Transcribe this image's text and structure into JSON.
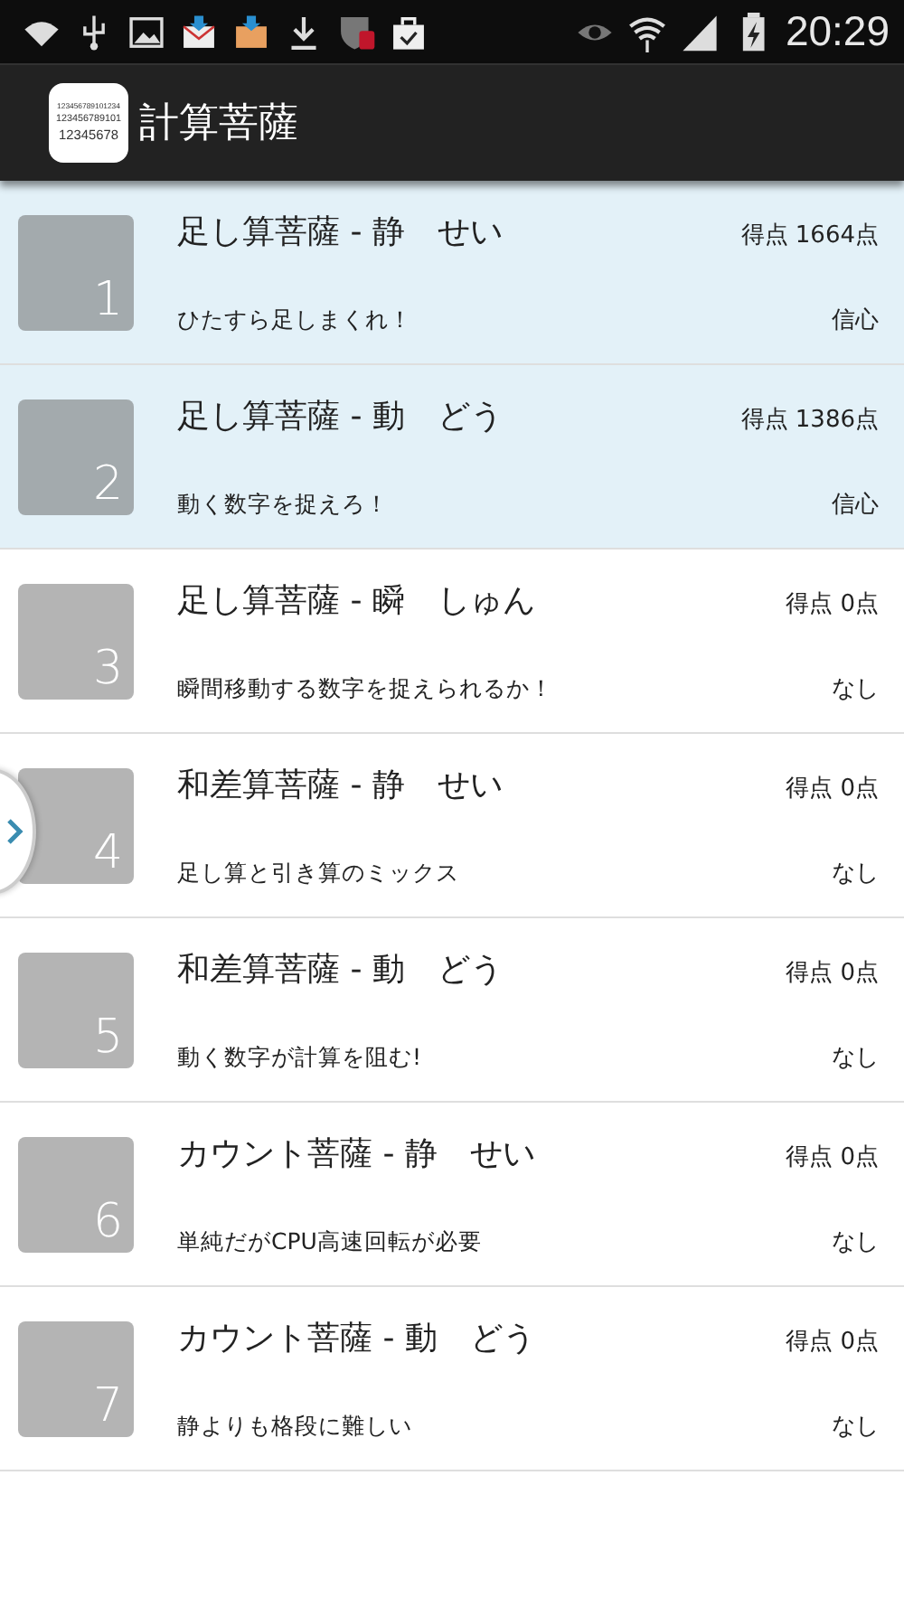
{
  "status_bar": {
    "time": "20:29"
  },
  "app_bar": {
    "icon_lines": [
      "123456789101234",
      "123456789101",
      "12345678"
    ],
    "title": "計算菩薩"
  },
  "games": [
    {
      "number": "1",
      "title": "足し算菩薩 - 静　せい",
      "score": "得点 1664点",
      "subtitle": "ひたすら足しまくれ！",
      "rank": "信心",
      "cleared": true
    },
    {
      "number": "2",
      "title": "足し算菩薩 - 動　どう",
      "score": "得点 1386点",
      "subtitle": "動く数字を捉えろ！",
      "rank": "信心",
      "cleared": true
    },
    {
      "number": "3",
      "title": "足し算菩薩 - 瞬　しゅん",
      "score": "得点 0点",
      "subtitle": "瞬間移動する数字を捉えられるか！",
      "rank": "なし",
      "cleared": false
    },
    {
      "number": "4",
      "title": "和差算菩薩 - 静　せい",
      "score": "得点 0点",
      "subtitle": "足し算と引き算のミックス",
      "rank": "なし",
      "cleared": false
    },
    {
      "number": "5",
      "title": "和差算菩薩 - 動　どう",
      "score": "得点 0点",
      "subtitle": "動く数字が計算を阻む!",
      "rank": "なし",
      "cleared": false
    },
    {
      "number": "6",
      "title": "カウント菩薩 - 静　せい",
      "score": "得点 0点",
      "subtitle": "単純だがCPU高速回転が必要",
      "rank": "なし",
      "cleared": false
    },
    {
      "number": "7",
      "title": "カウント菩薩 - 動　どう",
      "score": "得点 0点",
      "subtitle": "静よりも格段に難しい",
      "rank": "なし",
      "cleared": false
    }
  ]
}
